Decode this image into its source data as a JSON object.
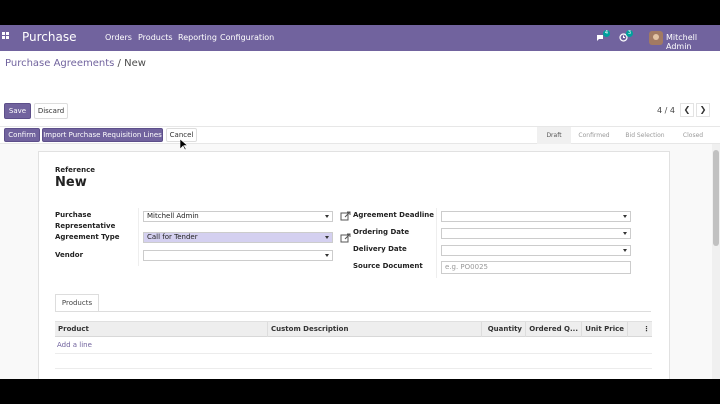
{
  "topbar": {
    "brand": "Purchase",
    "menu": [
      "Orders",
      "Products",
      "Reporting",
      "Configuration"
    ],
    "chat_badge": "4",
    "activity_badge": "3",
    "user": "Mitchell Admin"
  },
  "breadcrumb": {
    "parent": "Purchase Agreements",
    "separator": "/",
    "current": "New"
  },
  "buttons": {
    "save": "Save",
    "discard": "Discard",
    "confirm": "Confirm",
    "import_lines": "Import Purchase Requisition Lines",
    "cancel": "Cancel"
  },
  "pager": {
    "value": "4 / 4",
    "prev": "❮",
    "next": "❯"
  },
  "stages": [
    "Draft",
    "Confirmed",
    "Bid Selection",
    "Closed"
  ],
  "form": {
    "reference_label": "Reference",
    "reference_value": "New",
    "purchase_rep_label": "Purchase Representative",
    "purchase_rep_value": "Mitchell Admin",
    "agreement_type_label": "Agreement Type",
    "agreement_type_value": "Call for Tender",
    "vendor_label": "Vendor",
    "vendor_value": "",
    "agreement_deadline_label": "Agreement Deadline",
    "ordering_date_label": "Ordering Date",
    "delivery_date_label": "Delivery Date",
    "source_document_label": "Source Document",
    "source_document_placeholder": "e.g. PO0025"
  },
  "tabs": {
    "products": "Products"
  },
  "table": {
    "columns": [
      "Product",
      "Custom Description",
      "Quantity",
      "Ordered Q...",
      "Unit Price"
    ],
    "add_line": "Add a line",
    "options_icon": "⋮"
  },
  "colors": {
    "accent": "#71639e",
    "highlight": "#d4d0f0",
    "badge": "#00a09d"
  }
}
